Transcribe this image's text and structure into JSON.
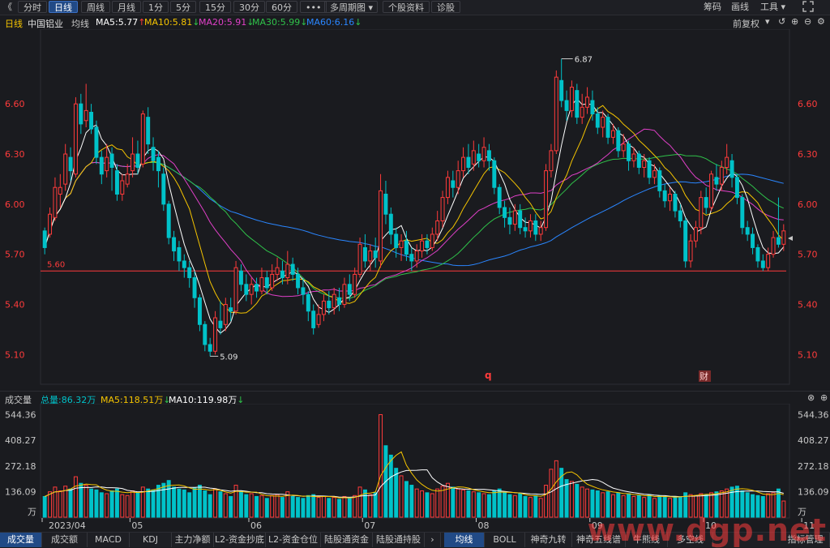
{
  "toolbar": {
    "collapse": "《",
    "tabs": [
      {
        "label": "分时",
        "active": false
      },
      {
        "label": "日线",
        "active": true
      },
      {
        "label": "周线",
        "active": false
      },
      {
        "label": "月线",
        "active": false
      },
      {
        "label": "1分",
        "active": false
      },
      {
        "label": "5分",
        "active": false
      },
      {
        "label": "15分",
        "active": false
      },
      {
        "label": "30分",
        "active": false
      },
      {
        "label": "60分",
        "active": false
      },
      {
        "label": "•••",
        "active": false
      }
    ],
    "multi_period": "多周期图",
    "profile": "个股资料",
    "diagnose": "诊股",
    "right": {
      "chips": "筹码",
      "draw": "画线",
      "tools": "工具"
    }
  },
  "infobar": {
    "period": "日线",
    "stock": "中国铝业",
    "avg": "均线",
    "ma5": "MA5:5.77",
    "ma10": "MA10:5.81",
    "ma20": "MA20:5.91",
    "ma30": "MA30:5.99",
    "ma60": "MA60:6.16",
    "adjust": "前复权"
  },
  "colors": {
    "up": "#ff3b3b",
    "down": "#00c2c9",
    "ma5": "#ffffff",
    "ma10": "#f5c400",
    "ma20": "#e040c8",
    "ma30": "#2fc24a",
    "ma60": "#2a86ff",
    "axis": "#ff3b3b",
    "bg": "#1a1b1f"
  },
  "main_chart": {
    "y_ticks": [
      "6.60",
      "6.30",
      "6.00",
      "5.70",
      "5.40",
      "5.10"
    ],
    "high_label": "6.87",
    "low_label": "5.09",
    "ref_label": "5.60",
    "marker_q": "q",
    "marker_cai": "财"
  },
  "volume": {
    "title": "成交量",
    "total": "总量:86.32万",
    "ma5": "MA5:118.51万",
    "ma10": "MA10:119.98万",
    "y_ticks": [
      "544.36",
      "408.27",
      "272.18",
      "136.09"
    ],
    "unit": "万",
    "x_labels": [
      "2023/04",
      "05",
      "06",
      "07",
      "08",
      "09",
      "10",
      "11"
    ]
  },
  "bottom_tabs": [
    {
      "label": "成交量",
      "active": true
    },
    {
      "label": "成交额",
      "active": false
    },
    {
      "label": "MACD",
      "active": false
    },
    {
      "label": "KDJ",
      "active": false
    },
    {
      "label": "主力净额",
      "active": false
    },
    {
      "label": "L2-资金抄底",
      "active": false
    },
    {
      "label": "L2-资金仓位",
      "active": false
    },
    {
      "label": "陆股通资金",
      "active": false
    },
    {
      "label": "陆股通持股",
      "active": false
    }
  ],
  "bottom_tabs_right": [
    {
      "label": "均线",
      "active": true
    },
    {
      "label": "BOLL",
      "active": false
    },
    {
      "label": "神奇九转",
      "active": false
    },
    {
      "label": "神奇五线谱",
      "active": false
    },
    {
      "label": "牛熊线",
      "active": false
    },
    {
      "label": "多空线",
      "active": false
    }
  ],
  "bottom_right": "指标管理",
  "watermark": "www.dgp.net",
  "chart_data": {
    "type": "candlestick",
    "ylim": [
      5.0,
      6.95
    ],
    "y_ticks": [
      6.6,
      6.3,
      6.0,
      5.7,
      5.4,
      5.1
    ],
    "reference_line": 5.6,
    "x_labels": [
      "2023/04",
      "05",
      "06",
      "07",
      "08",
      "09",
      "10",
      "11"
    ],
    "volume_ylim": [
      0,
      560
    ],
    "volume_ticks": [
      544.36,
      408.27,
      272.18,
      136.09
    ],
    "days": [
      {
        "o": 5.84,
        "c": 5.74,
        "h": 5.86,
        "l": 5.7,
        "v": 110
      },
      {
        "o": 5.82,
        "c": 5.94,
        "h": 5.98,
        "l": 5.8,
        "v": 135
      },
      {
        "o": 5.92,
        "c": 6.1,
        "h": 6.16,
        "l": 5.9,
        "v": 160
      },
      {
        "o": 6.06,
        "c": 6.1,
        "h": 6.18,
        "l": 5.98,
        "v": 140
      },
      {
        "o": 6.12,
        "c": 6.3,
        "h": 6.36,
        "l": 6.08,
        "v": 165
      },
      {
        "o": 6.28,
        "c": 6.2,
        "h": 6.34,
        "l": 6.14,
        "v": 150
      },
      {
        "o": 6.18,
        "c": 6.6,
        "h": 6.64,
        "l": 6.16,
        "v": 215
      },
      {
        "o": 6.6,
        "c": 6.48,
        "h": 6.66,
        "l": 6.42,
        "v": 180
      },
      {
        "o": 6.5,
        "c": 6.56,
        "h": 6.72,
        "l": 6.46,
        "v": 170
      },
      {
        "o": 6.55,
        "c": 6.45,
        "h": 6.6,
        "l": 6.42,
        "v": 150
      },
      {
        "o": 6.46,
        "c": 6.28,
        "h": 6.5,
        "l": 6.24,
        "v": 145
      },
      {
        "o": 6.28,
        "c": 6.18,
        "h": 6.32,
        "l": 6.12,
        "v": 130
      },
      {
        "o": 6.2,
        "c": 6.28,
        "h": 6.36,
        "l": 6.16,
        "v": 125
      },
      {
        "o": 6.3,
        "c": 6.22,
        "h": 6.34,
        "l": 6.08,
        "v": 140
      },
      {
        "o": 6.2,
        "c": 6.06,
        "h": 6.24,
        "l": 6.02,
        "v": 150
      },
      {
        "o": 6.06,
        "c": 6.14,
        "h": 6.18,
        "l": 6.02,
        "v": 120
      },
      {
        "o": 6.12,
        "c": 6.18,
        "h": 6.24,
        "l": 6.1,
        "v": 115
      },
      {
        "o": 6.2,
        "c": 6.3,
        "h": 6.4,
        "l": 6.16,
        "v": 140
      },
      {
        "o": 6.3,
        "c": 6.22,
        "h": 6.38,
        "l": 6.18,
        "v": 130
      },
      {
        "o": 6.24,
        "c": 6.54,
        "h": 6.56,
        "l": 6.22,
        "v": 160
      },
      {
        "o": 6.52,
        "c": 6.36,
        "h": 6.58,
        "l": 6.3,
        "v": 150
      },
      {
        "o": 6.34,
        "c": 6.26,
        "h": 6.4,
        "l": 6.2,
        "v": 145
      },
      {
        "o": 6.28,
        "c": 6.2,
        "h": 6.32,
        "l": 6.1,
        "v": 170
      },
      {
        "o": 6.18,
        "c": 6.0,
        "h": 6.22,
        "l": 5.96,
        "v": 180
      },
      {
        "o": 6.0,
        "c": 5.8,
        "h": 6.02,
        "l": 5.76,
        "v": 195
      },
      {
        "o": 5.8,
        "c": 5.72,
        "h": 5.84,
        "l": 5.66,
        "v": 160
      },
      {
        "o": 5.74,
        "c": 5.66,
        "h": 5.78,
        "l": 5.6,
        "v": 150
      },
      {
        "o": 5.66,
        "c": 5.62,
        "h": 5.7,
        "l": 5.56,
        "v": 145
      },
      {
        "o": 5.62,
        "c": 5.56,
        "h": 5.66,
        "l": 5.5,
        "v": 130
      },
      {
        "o": 5.56,
        "c": 5.44,
        "h": 5.6,
        "l": 5.38,
        "v": 155
      },
      {
        "o": 5.44,
        "c": 5.28,
        "h": 5.46,
        "l": 5.24,
        "v": 170
      },
      {
        "o": 5.28,
        "c": 5.16,
        "h": 5.3,
        "l": 5.12,
        "v": 140
      },
      {
        "o": 5.16,
        "c": 5.12,
        "h": 5.2,
        "l": 5.09,
        "v": 120
      },
      {
        "o": 5.12,
        "c": 5.32,
        "h": 5.36,
        "l": 5.1,
        "v": 150
      },
      {
        "o": 5.3,
        "c": 5.26,
        "h": 5.42,
        "l": 5.22,
        "v": 135
      },
      {
        "o": 5.28,
        "c": 5.4,
        "h": 5.44,
        "l": 5.24,
        "v": 125
      },
      {
        "o": 5.38,
        "c": 5.36,
        "h": 5.44,
        "l": 5.3,
        "v": 110
      },
      {
        "o": 5.36,
        "c": 5.62,
        "h": 5.66,
        "l": 5.34,
        "v": 170
      },
      {
        "o": 5.6,
        "c": 5.52,
        "h": 5.64,
        "l": 5.48,
        "v": 140
      },
      {
        "o": 5.52,
        "c": 5.46,
        "h": 5.58,
        "l": 5.42,
        "v": 120
      },
      {
        "o": 5.46,
        "c": 5.52,
        "h": 5.56,
        "l": 5.4,
        "v": 125
      },
      {
        "o": 5.52,
        "c": 5.48,
        "h": 5.56,
        "l": 5.44,
        "v": 110
      },
      {
        "o": 5.48,
        "c": 5.56,
        "h": 5.62,
        "l": 5.46,
        "v": 115
      },
      {
        "o": 5.56,
        "c": 5.5,
        "h": 5.6,
        "l": 5.46,
        "v": 100
      },
      {
        "o": 5.5,
        "c": 5.58,
        "h": 5.64,
        "l": 5.48,
        "v": 115
      },
      {
        "o": 5.58,
        "c": 5.62,
        "h": 5.68,
        "l": 5.54,
        "v": 120
      },
      {
        "o": 5.6,
        "c": 5.56,
        "h": 5.66,
        "l": 5.52,
        "v": 105
      },
      {
        "o": 5.56,
        "c": 5.64,
        "h": 5.72,
        "l": 5.52,
        "v": 135
      },
      {
        "o": 5.64,
        "c": 5.58,
        "h": 5.68,
        "l": 5.54,
        "v": 110
      },
      {
        "o": 5.58,
        "c": 5.5,
        "h": 5.62,
        "l": 5.46,
        "v": 105
      },
      {
        "o": 5.5,
        "c": 5.46,
        "h": 5.56,
        "l": 5.4,
        "v": 100
      },
      {
        "o": 5.46,
        "c": 5.36,
        "h": 5.48,
        "l": 5.3,
        "v": 115
      },
      {
        "o": 5.36,
        "c": 5.26,
        "h": 5.4,
        "l": 5.22,
        "v": 120
      },
      {
        "o": 5.28,
        "c": 5.34,
        "h": 5.4,
        "l": 5.26,
        "v": 105
      },
      {
        "o": 5.34,
        "c": 5.42,
        "h": 5.46,
        "l": 5.3,
        "v": 110
      },
      {
        "o": 5.42,
        "c": 5.38,
        "h": 5.48,
        "l": 5.34,
        "v": 100
      },
      {
        "o": 5.38,
        "c": 5.46,
        "h": 5.5,
        "l": 5.34,
        "v": 105
      },
      {
        "o": 5.44,
        "c": 5.4,
        "h": 5.5,
        "l": 5.36,
        "v": 95
      },
      {
        "o": 5.4,
        "c": 5.52,
        "h": 5.56,
        "l": 5.38,
        "v": 110
      },
      {
        "o": 5.52,
        "c": 5.46,
        "h": 5.58,
        "l": 5.42,
        "v": 100
      },
      {
        "o": 5.46,
        "c": 5.58,
        "h": 5.62,
        "l": 5.44,
        "v": 115
      },
      {
        "o": 5.58,
        "c": 5.76,
        "h": 5.8,
        "l": 5.56,
        "v": 160
      },
      {
        "o": 5.74,
        "c": 5.66,
        "h": 5.82,
        "l": 5.62,
        "v": 145
      },
      {
        "o": 5.66,
        "c": 5.72,
        "h": 5.76,
        "l": 5.6,
        "v": 120
      },
      {
        "o": 5.72,
        "c": 5.68,
        "h": 5.8,
        "l": 5.62,
        "v": 130
      },
      {
        "o": 5.66,
        "c": 6.08,
        "h": 6.18,
        "l": 5.62,
        "v": 545
      },
      {
        "o": 6.06,
        "c": 5.94,
        "h": 6.14,
        "l": 5.88,
        "v": 380
      },
      {
        "o": 5.94,
        "c": 5.82,
        "h": 5.98,
        "l": 5.76,
        "v": 330
      },
      {
        "o": 5.82,
        "c": 5.74,
        "h": 5.86,
        "l": 5.68,
        "v": 260
      },
      {
        "o": 5.74,
        "c": 5.78,
        "h": 5.82,
        "l": 5.66,
        "v": 220
      },
      {
        "o": 5.78,
        "c": 5.7,
        "h": 5.84,
        "l": 5.66,
        "v": 190
      },
      {
        "o": 5.7,
        "c": 5.66,
        "h": 5.74,
        "l": 5.6,
        "v": 170
      },
      {
        "o": 5.66,
        "c": 5.72,
        "h": 5.76,
        "l": 5.62,
        "v": 150
      },
      {
        "o": 5.72,
        "c": 5.78,
        "h": 5.82,
        "l": 5.68,
        "v": 140
      },
      {
        "o": 5.78,
        "c": 5.74,
        "h": 5.82,
        "l": 5.7,
        "v": 130
      },
      {
        "o": 5.74,
        "c": 5.82,
        "h": 5.86,
        "l": 5.72,
        "v": 125
      },
      {
        "o": 5.82,
        "c": 5.9,
        "h": 5.96,
        "l": 5.78,
        "v": 150
      },
      {
        "o": 5.9,
        "c": 6.04,
        "h": 6.08,
        "l": 5.86,
        "v": 165
      },
      {
        "o": 6.04,
        "c": 6.16,
        "h": 6.2,
        "l": 6.0,
        "v": 180
      },
      {
        "o": 6.14,
        "c": 6.1,
        "h": 6.2,
        "l": 6.04,
        "v": 160
      },
      {
        "o": 6.1,
        "c": 6.2,
        "h": 6.26,
        "l": 6.06,
        "v": 150
      },
      {
        "o": 6.2,
        "c": 6.28,
        "h": 6.34,
        "l": 6.16,
        "v": 145
      },
      {
        "o": 6.28,
        "c": 6.22,
        "h": 6.36,
        "l": 6.18,
        "v": 140
      },
      {
        "o": 6.24,
        "c": 6.32,
        "h": 6.38,
        "l": 6.2,
        "v": 135
      },
      {
        "o": 6.3,
        "c": 6.26,
        "h": 6.36,
        "l": 6.22,
        "v": 130
      },
      {
        "o": 6.26,
        "c": 6.34,
        "h": 6.4,
        "l": 6.22,
        "v": 125
      },
      {
        "o": 6.32,
        "c": 6.26,
        "h": 6.36,
        "l": 6.2,
        "v": 120
      },
      {
        "o": 6.26,
        "c": 6.1,
        "h": 6.28,
        "l": 6.06,
        "v": 140
      },
      {
        "o": 6.1,
        "c": 5.98,
        "h": 6.12,
        "l": 5.94,
        "v": 150
      },
      {
        "o": 5.98,
        "c": 5.92,
        "h": 6.02,
        "l": 5.86,
        "v": 130
      },
      {
        "o": 5.92,
        "c": 5.88,
        "h": 5.98,
        "l": 5.82,
        "v": 120
      },
      {
        "o": 5.88,
        "c": 5.96,
        "h": 6.0,
        "l": 5.84,
        "v": 115
      },
      {
        "o": 5.96,
        "c": 5.86,
        "h": 6.0,
        "l": 5.82,
        "v": 125
      },
      {
        "o": 5.86,
        "c": 5.84,
        "h": 5.92,
        "l": 5.8,
        "v": 110
      },
      {
        "o": 5.84,
        "c": 5.9,
        "h": 5.94,
        "l": 5.8,
        "v": 105
      },
      {
        "o": 5.9,
        "c": 5.82,
        "h": 5.94,
        "l": 5.78,
        "v": 115
      },
      {
        "o": 5.82,
        "c": 5.86,
        "h": 5.9,
        "l": 5.78,
        "v": 100
      },
      {
        "o": 5.86,
        "c": 6.2,
        "h": 6.24,
        "l": 5.84,
        "v": 170
      },
      {
        "o": 6.2,
        "c": 6.32,
        "h": 6.36,
        "l": 6.16,
        "v": 255
      },
      {
        "o": 6.32,
        "c": 6.76,
        "h": 6.8,
        "l": 6.3,
        "v": 300
      },
      {
        "o": 6.74,
        "c": 6.62,
        "h": 6.87,
        "l": 6.58,
        "v": 260
      },
      {
        "o": 6.62,
        "c": 6.56,
        "h": 6.68,
        "l": 6.5,
        "v": 200
      },
      {
        "o": 6.56,
        "c": 6.7,
        "h": 6.74,
        "l": 6.52,
        "v": 190
      },
      {
        "o": 6.68,
        "c": 6.52,
        "h": 6.72,
        "l": 6.48,
        "v": 175
      },
      {
        "o": 6.52,
        "c": 6.58,
        "h": 6.66,
        "l": 6.48,
        "v": 160
      },
      {
        "o": 6.58,
        "c": 6.64,
        "h": 6.7,
        "l": 6.54,
        "v": 150
      },
      {
        "o": 6.62,
        "c": 6.54,
        "h": 6.68,
        "l": 6.5,
        "v": 145
      },
      {
        "o": 6.54,
        "c": 6.46,
        "h": 6.58,
        "l": 6.42,
        "v": 140
      },
      {
        "o": 6.46,
        "c": 6.52,
        "h": 6.56,
        "l": 6.4,
        "v": 130
      },
      {
        "o": 6.52,
        "c": 6.4,
        "h": 6.54,
        "l": 6.36,
        "v": 135
      },
      {
        "o": 6.4,
        "c": 6.44,
        "h": 6.48,
        "l": 6.36,
        "v": 120
      },
      {
        "o": 6.44,
        "c": 6.32,
        "h": 6.46,
        "l": 6.28,
        "v": 130
      },
      {
        "o": 6.32,
        "c": 6.36,
        "h": 6.42,
        "l": 6.28,
        "v": 115
      },
      {
        "o": 6.36,
        "c": 6.26,
        "h": 6.38,
        "l": 6.2,
        "v": 125
      },
      {
        "o": 6.26,
        "c": 6.3,
        "h": 6.34,
        "l": 6.22,
        "v": 110
      },
      {
        "o": 6.3,
        "c": 6.22,
        "h": 6.32,
        "l": 6.18,
        "v": 115
      },
      {
        "o": 6.22,
        "c": 6.26,
        "h": 6.3,
        "l": 6.16,
        "v": 105
      },
      {
        "o": 6.26,
        "c": 6.16,
        "h": 6.28,
        "l": 6.12,
        "v": 120
      },
      {
        "o": 6.16,
        "c": 6.2,
        "h": 6.24,
        "l": 6.12,
        "v": 100
      },
      {
        "o": 6.2,
        "c": 6.08,
        "h": 6.22,
        "l": 6.04,
        "v": 115
      },
      {
        "o": 6.08,
        "c": 6.02,
        "h": 6.12,
        "l": 5.98,
        "v": 110
      },
      {
        "o": 6.02,
        "c": 6.06,
        "h": 6.1,
        "l": 5.96,
        "v": 100
      },
      {
        "o": 6.06,
        "c": 5.96,
        "h": 6.08,
        "l": 5.92,
        "v": 110
      },
      {
        "o": 5.96,
        "c": 5.9,
        "h": 6.0,
        "l": 5.86,
        "v": 105
      },
      {
        "o": 5.9,
        "c": 5.66,
        "h": 5.92,
        "l": 5.62,
        "v": 130
      },
      {
        "o": 5.66,
        "c": 5.78,
        "h": 5.82,
        "l": 5.62,
        "v": 120
      },
      {
        "o": 5.78,
        "c": 5.86,
        "h": 5.9,
        "l": 5.74,
        "v": 115
      },
      {
        "o": 5.86,
        "c": 6.04,
        "h": 6.08,
        "l": 5.82,
        "v": 125
      },
      {
        "o": 6.04,
        "c": 5.98,
        "h": 6.1,
        "l": 5.94,
        "v": 120
      },
      {
        "o": 5.98,
        "c": 6.18,
        "h": 6.2,
        "l": 5.96,
        "v": 130
      },
      {
        "o": 6.16,
        "c": 6.12,
        "h": 6.24,
        "l": 6.08,
        "v": 135
      },
      {
        "o": 6.12,
        "c": 6.22,
        "h": 6.26,
        "l": 6.08,
        "v": 140
      },
      {
        "o": 6.22,
        "c": 6.28,
        "h": 6.36,
        "l": 6.18,
        "v": 150
      },
      {
        "o": 6.26,
        "c": 6.16,
        "h": 6.3,
        "l": 6.1,
        "v": 160
      },
      {
        "o": 6.16,
        "c": 6.04,
        "h": 6.18,
        "l": 6.0,
        "v": 165
      },
      {
        "o": 6.04,
        "c": 5.86,
        "h": 6.06,
        "l": 5.82,
        "v": 140
      },
      {
        "o": 5.86,
        "c": 5.82,
        "h": 5.9,
        "l": 5.78,
        "v": 130
      },
      {
        "o": 5.82,
        "c": 5.74,
        "h": 5.86,
        "l": 5.7,
        "v": 120
      },
      {
        "o": 5.74,
        "c": 5.66,
        "h": 5.76,
        "l": 5.62,
        "v": 115
      },
      {
        "o": 5.66,
        "c": 5.62,
        "h": 5.7,
        "l": 5.6,
        "v": 110
      },
      {
        "o": 5.62,
        "c": 5.7,
        "h": 5.74,
        "l": 5.6,
        "v": 125
      },
      {
        "o": 5.7,
        "c": 5.8,
        "h": 5.84,
        "l": 5.68,
        "v": 130
      },
      {
        "o": 5.8,
        "c": 5.76,
        "h": 6.04,
        "l": 5.74,
        "v": 150
      },
      {
        "o": 5.76,
        "c": 5.84,
        "h": 5.88,
        "l": 5.72,
        "v": 86
      }
    ]
  }
}
